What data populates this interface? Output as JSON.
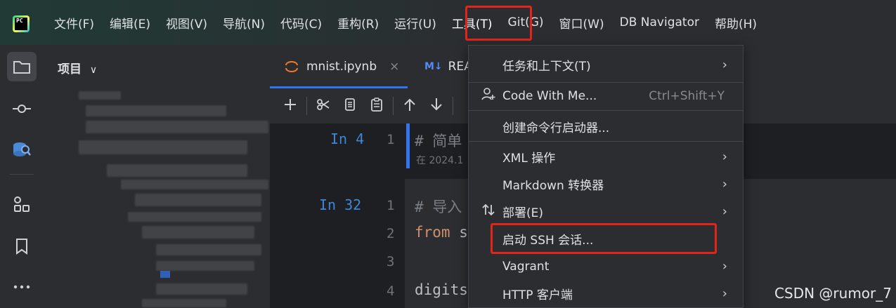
{
  "menubar": {
    "logo_text": "PC",
    "items": [
      "文件(F)",
      "编辑(E)",
      "视图(V)",
      "导航(N)",
      "代码(C)",
      "重构(R)",
      "运行(U)",
      "工具(T)",
      "Git(G)",
      "窗口(W)",
      "DB Navigator",
      "帮助(H)"
    ]
  },
  "project": {
    "title": "项目",
    "chevron": "∨"
  },
  "tabs": [
    {
      "label": "mnist.ipynb",
      "close": "×"
    },
    {
      "icon": "M↓",
      "label": "REA"
    }
  ],
  "notebook": {
    "cells": [
      {
        "prompt": "In 4",
        "lines": [
          {
            "no": "1",
            "text": "# 简单"
          }
        ],
        "meta": "在 2024.1"
      },
      {
        "prompt": "In 32",
        "lines": [
          {
            "no": "1",
            "text": "# 导入"
          },
          {
            "no": "2",
            "kw": "from",
            "text": " s"
          },
          {
            "no": "3",
            "text": ""
          },
          {
            "no": "4",
            "text": "digits"
          }
        ]
      }
    ]
  },
  "dropdown": {
    "items": [
      {
        "label": "任务和上下文(T)",
        "submenu": true
      },
      {
        "label": "Code With Me...",
        "shortcut": "Ctrl+Shift+Y",
        "icon": "user-add-icon"
      },
      {
        "label": "创建命令行启动器..."
      },
      {
        "label": "XML 操作",
        "submenu": true
      },
      {
        "label": "Markdown 转换器",
        "submenu": true
      },
      {
        "label": "部署(E)",
        "submenu": true,
        "icon": "deploy-icon"
      },
      {
        "label": "启动 SSH 会话..."
      },
      {
        "label": "Vagrant",
        "submenu": true
      },
      {
        "label": "HTTP 客户端",
        "submenu": true
      }
    ],
    "arrow": "›"
  },
  "watermark": "CSDN @rumor_7",
  "colors": {
    "accent": "#3574f0",
    "highlight": "#e1251b",
    "background": "#1e1f22",
    "panel": "#2b2d30"
  }
}
